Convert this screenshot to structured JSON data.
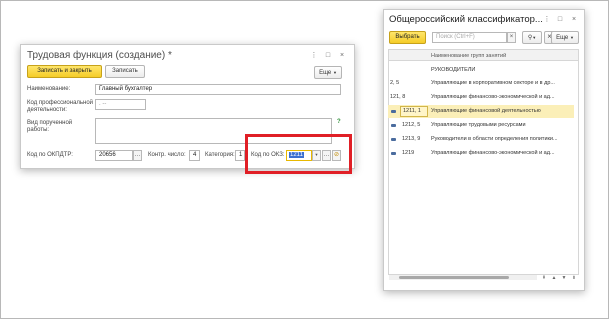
{
  "left_window": {
    "title": "Трудовая функция (создание) *",
    "controls": {
      "more": "⋮",
      "maximize": "□",
      "close": "×"
    },
    "toolbar": {
      "save_close_label": "Записать и закрыть",
      "save_label": "Записать",
      "more_label": "Еще"
    },
    "fields": {
      "name_label": "Наименование:",
      "name_value": "Главный бухгалтер",
      "prof_code_label_1": "Код профессиональной",
      "prof_code_label_2": "деятельности:",
      "prof_code_value": ". --",
      "work_type_label_1": "Вид порученной",
      "work_type_label_2": "работы:",
      "work_type_value": "",
      "help_mark": "?",
      "okpdtr_label": "Код по ОКПДТР:",
      "okpdtr_value": "20656",
      "control_num_label": "Контр. число:",
      "control_num_value": "4",
      "category_label": "Категория:",
      "category_value": "1",
      "okz_label": "Код по ОКЗ:",
      "okz_value": "1211"
    }
  },
  "right_window": {
    "title": "Общероссийский классификатор...",
    "controls": {
      "more": "⋮",
      "maximize": "□",
      "close": "×"
    },
    "toolbar": {
      "select_label": "Выбрать",
      "search_placeholder": "Поиск (Ctrl+F)",
      "more_label": "Еще"
    },
    "table": {
      "header_name": "Наименование групп занятий",
      "rows": [
        {
          "code": "",
          "name": "РУКОВОДИТЕЛИ"
        },
        {
          "code": "2, 5",
          "name": "Управляющие в корпоративном секторе и в др..."
        },
        {
          "code": "121, 8",
          "name": "Управляющие финансово-экономической и ад..."
        },
        {
          "code": "1211, 1",
          "name": "Управляющие финансовой деятельностью"
        },
        {
          "code": "1212, 5",
          "name": "Управляющие трудовыми ресурсами"
        },
        {
          "code": "1213, 9",
          "name": "Руководители в области определения политики..."
        },
        {
          "code": "1219",
          "name": "Управляющие финансово-экономической и ад..."
        }
      ]
    }
  },
  "colors": {
    "highlight_frame": "#e01f26",
    "accent_button": "#f5cc28",
    "selected_row": "#fbefb8",
    "okz_selection": "#3b6fd1"
  }
}
